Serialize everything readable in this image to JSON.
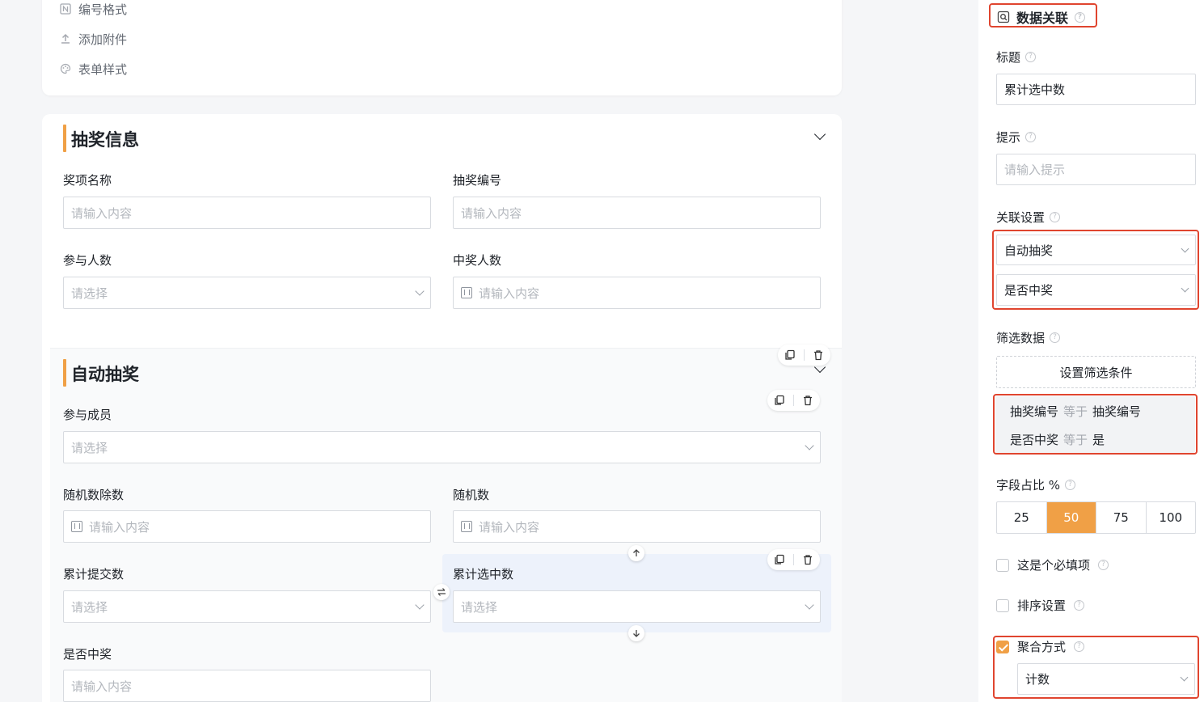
{
  "tools": [
    {
      "label": "编号格式",
      "icon": "number-format-icon"
    },
    {
      "label": "添加附件",
      "icon": "upload-icon"
    },
    {
      "label": "表单样式",
      "icon": "palette-icon"
    }
  ],
  "section1": {
    "title": "抽奖信息",
    "fields": [
      {
        "label": "奖项名称",
        "placeholder": "请输入内容"
      },
      {
        "label": "抽奖编号",
        "placeholder": "请输入内容"
      },
      {
        "label": "参与人数",
        "placeholder": "请选择"
      },
      {
        "label": "中奖人数",
        "placeholder": "请输入内容"
      }
    ]
  },
  "section2": {
    "title": "自动抽奖",
    "fields": [
      {
        "label": "参与成员",
        "placeholder": "请选择"
      },
      {
        "label": "随机数除数",
        "placeholder": "请输入内容"
      },
      {
        "label": "随机数",
        "placeholder": "请输入内容"
      },
      {
        "label": "累计提交数",
        "placeholder": "请选择"
      },
      {
        "label": "累计选中数",
        "placeholder": "请选择"
      },
      {
        "label": "是否中奖",
        "placeholder": "请输入内容"
      }
    ]
  },
  "panel": {
    "header": "数据关联",
    "title_label": "标题",
    "title_value": "累计选中数",
    "hint_label": "提示",
    "hint_placeholder": "请输入提示",
    "relation_label": "关联设置",
    "relation_form": "自动抽奖",
    "relation_field": "是否中奖",
    "filter_label": "筛选数据",
    "filter_button": "设置筛选条件",
    "conditions": [
      {
        "field": "抽奖编号",
        "op": "等于",
        "value": "抽奖编号"
      },
      {
        "field": "是否中奖",
        "op": "等于",
        "value": "是"
      }
    ],
    "width_label": "字段占比 %",
    "width_options": [
      "25",
      "50",
      "75",
      "100"
    ],
    "width_selected": "50",
    "required_label": "这是个必填项",
    "sort_label": "排序设置",
    "aggregate_label": "聚合方式",
    "aggregate_value": "计数",
    "accent_color": "#f0a046",
    "highlight_color": "#e0452f"
  }
}
